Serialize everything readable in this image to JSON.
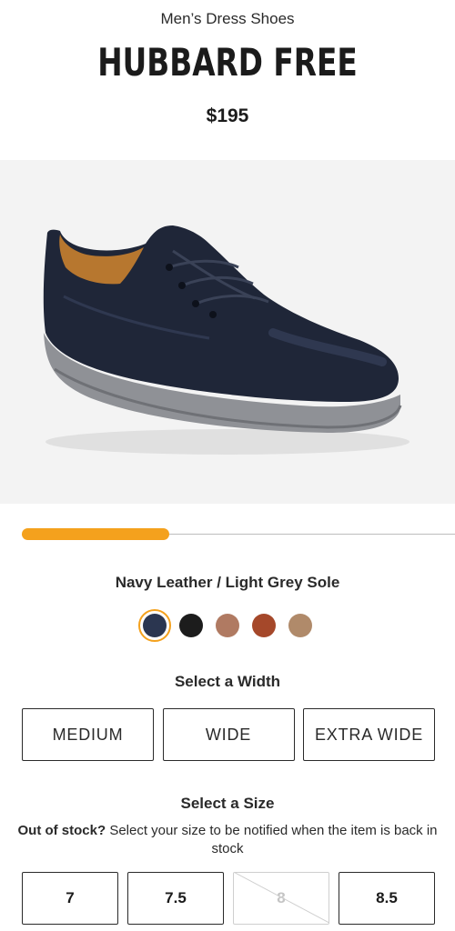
{
  "product": {
    "category": "Men’s Dress Shoes",
    "name": "HUBBARD FREE",
    "price": "$195"
  },
  "image_carousel": {
    "progress_fraction": 0.34
  },
  "color": {
    "selected_label": "Navy Leather / Light Grey Sole",
    "swatches": [
      {
        "name": "navy",
        "hex": "#2b3650",
        "selected": true
      },
      {
        "name": "black",
        "hex": "#1c1c1c",
        "selected": false
      },
      {
        "name": "light-brown",
        "hex": "#b07a62",
        "selected": false
      },
      {
        "name": "rust-brown",
        "hex": "#a5482a",
        "selected": false
      },
      {
        "name": "tan",
        "hex": "#b08a6a",
        "selected": false
      }
    ]
  },
  "width": {
    "heading": "Select a Width",
    "options": [
      "MEDIUM",
      "WIDE",
      "EXTRA WIDE"
    ]
  },
  "size": {
    "heading": "Select a Size",
    "stock_bold": "Out of stock?",
    "stock_text": " Select your size to be notified when the item is back in stock",
    "options": [
      {
        "label": "7",
        "available": true
      },
      {
        "label": "7.5",
        "available": true
      },
      {
        "label": "8",
        "available": false
      },
      {
        "label": "8.5",
        "available": true
      }
    ]
  },
  "colors": {
    "accent": "#f4a11d",
    "hero_background": "#f3f3f3"
  }
}
